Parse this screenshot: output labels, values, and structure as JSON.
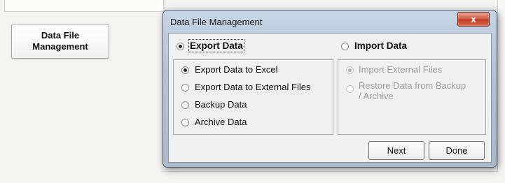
{
  "background": {
    "data_file_button_label": "Data File Management"
  },
  "dialog": {
    "title": "Data File Management",
    "close_glyph": "x",
    "export": {
      "header": "Export Data",
      "selected": true,
      "options": [
        {
          "label": "Export Data to Excel",
          "checked": true
        },
        {
          "label": "Export Data to External Files",
          "checked": false
        },
        {
          "label": "Backup Data",
          "checked": false
        },
        {
          "label": "Archive Data",
          "checked": false
        }
      ]
    },
    "import": {
      "header": "Import Data",
      "selected": false,
      "options": [
        {
          "label": "Import External Files",
          "checked": true,
          "disabled": true
        },
        {
          "label": "Restore Data from Backup / Archive",
          "checked": false,
          "disabled": true
        }
      ]
    },
    "buttons": {
      "next": "Next",
      "done": "Done"
    }
  },
  "colors": {
    "title_bar": "#b8c8da",
    "close_button": "#c9442b",
    "disabled_text": "#9d9d9d"
  },
  "icons": {
    "close": "close-icon",
    "radio": "radio-button-icon"
  }
}
